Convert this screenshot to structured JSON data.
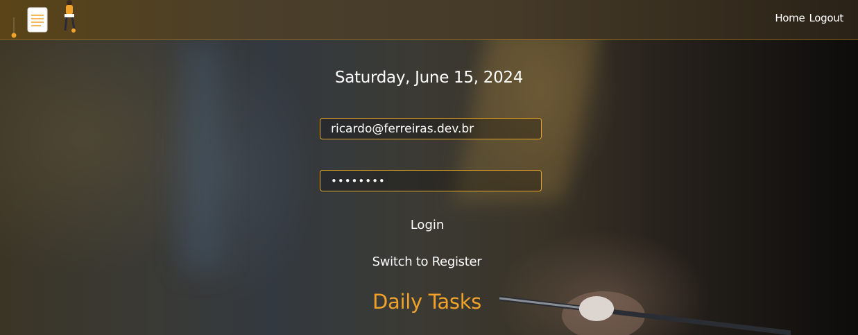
{
  "header": {
    "nav": {
      "home_label": "Home",
      "logout_label": "Logout"
    }
  },
  "main": {
    "date_text": "Saturday, June 15, 2024",
    "email": {
      "value": "ricardo@ferreiras.dev.br"
    },
    "password": {
      "masked_value": "••••••••"
    },
    "login_label": "Login",
    "switch_label": "Switch to Register",
    "app_title": "Daily Tasks"
  },
  "colors": {
    "accent": "#f0a22a",
    "field_border": "#e7a52a",
    "header_bg": "#4a3f2b"
  },
  "icons": {
    "logo": "task-list-illustration-icon"
  }
}
